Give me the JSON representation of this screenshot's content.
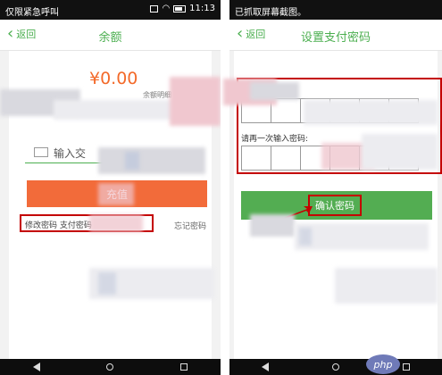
{
  "left": {
    "status": {
      "text": "仅限紧急呼叫",
      "time": "11:13"
    },
    "nav": {
      "back_label": "返回",
      "title": "余额"
    },
    "balance": {
      "amount": "¥0.00",
      "detail_label": "余额明细"
    },
    "input_label": "输入交",
    "pay_button_label": "充值",
    "boxed_text": "修改密码 支付密码",
    "forgot_label": "忘记密码"
  },
  "right": {
    "status": {
      "text": "已抓取屏幕截图。"
    },
    "nav": {
      "back_label": "返回",
      "title": "设置支付密码"
    },
    "reenter_label": "请再一次输入密码:",
    "confirm_label": "确认密码"
  },
  "watermark": "php",
  "colors": {
    "accent_green": "#4caf50",
    "orange": "#f36a2a",
    "annotation_red": "#c40000"
  }
}
